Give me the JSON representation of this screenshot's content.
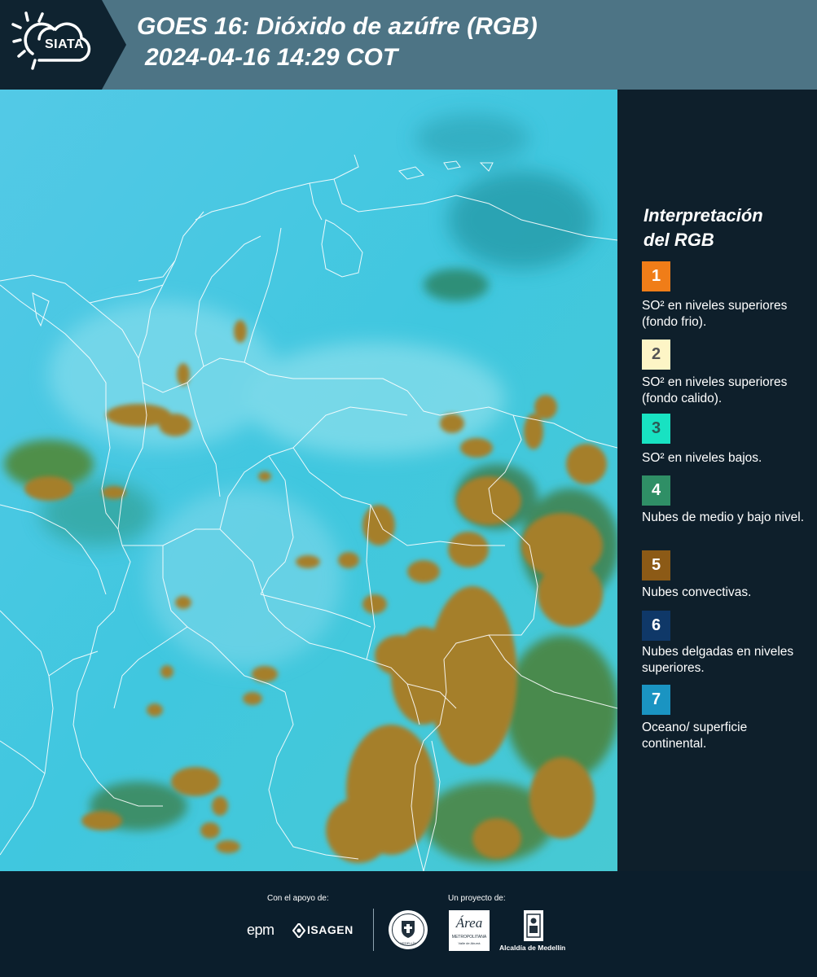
{
  "header": {
    "logo_text": "SIATA",
    "title_line1": "GOES 16: Dióxido de azúfre (RGB)",
    "title_line2": "2024-04-16 14:29 COT"
  },
  "legend": {
    "title_line1": "Interpretación",
    "title_line2": "del RGB",
    "items": [
      {
        "number": "1",
        "color": "#f07d18",
        "text_color": "#ffffff",
        "description": "SO² en niveles superiores (fondo frio)."
      },
      {
        "number": "2",
        "color": "#fdf5c6",
        "text_color": "#555555",
        "description": "SO² en niveles superiores (fondo calido)."
      },
      {
        "number": "3",
        "color": "#18e2c2",
        "text_color": "#2a5a55",
        "description": "SO² en niveles bajos."
      },
      {
        "number": "4",
        "color": "#2f8f66",
        "text_color": "#ffffff",
        "description": "Nubes de medio y bajo nivel."
      },
      {
        "number": "5",
        "color": "#8c5a16",
        "text_color": "#ffffff",
        "description": "Nubes convectivas."
      },
      {
        "number": "6",
        "color": "#0f3868",
        "text_color": "#ffffff",
        "description": "Nubes delgadas en niveles superiores."
      },
      {
        "number": "7",
        "color": "#1a94c2",
        "text_color": "#ffffff",
        "description": "Oceano/ superficie continental."
      }
    ]
  },
  "footer": {
    "support_label": "Con el apoyo de:",
    "project_label": "Un proyecto de:",
    "sponsor1": "epm",
    "sponsor2": "ISAGEN",
    "seal_text": "MEDELLÍN",
    "area_logo": "Área",
    "area_line1": "METROPOLITANA",
    "area_line2": "Valle de Aburrá",
    "alcaldia": "Alcaldía de Medellín"
  }
}
